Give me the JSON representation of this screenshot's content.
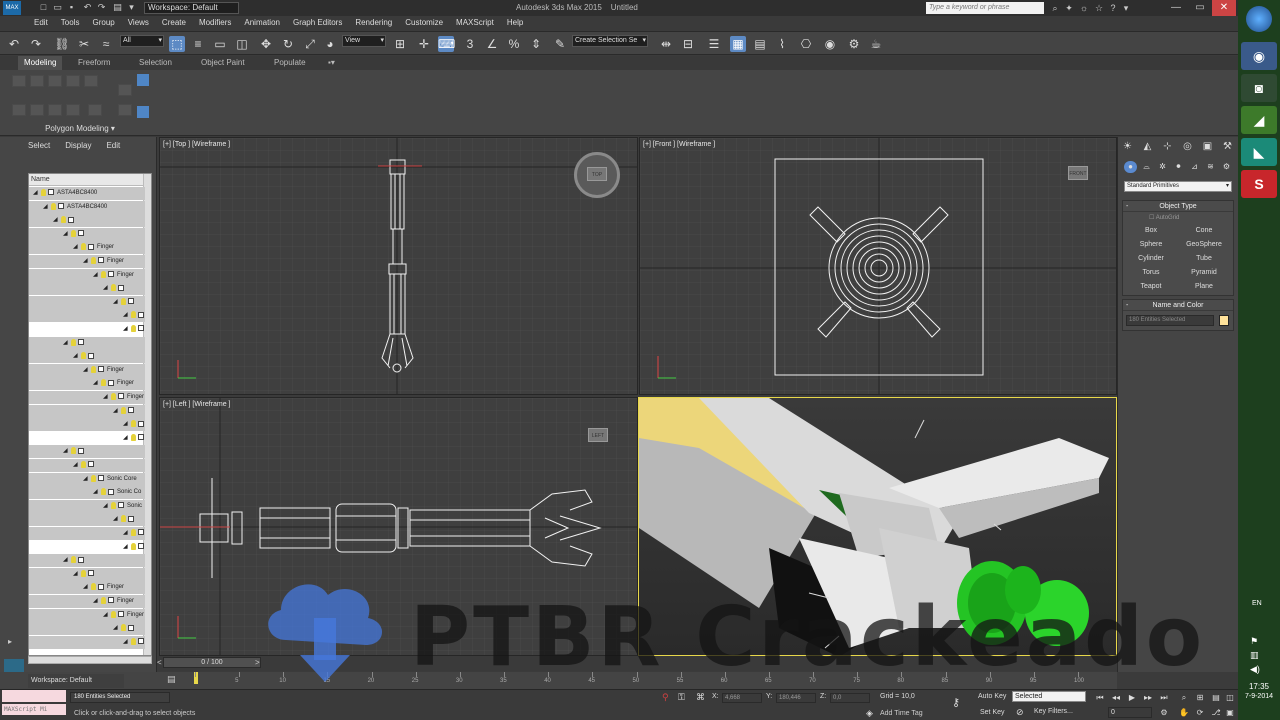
{
  "window": {
    "title": "Autodesk 3ds Max 2015",
    "document": "Untitled",
    "workspace": "Workspace: Default",
    "search_placeholder": "Type a keyword or phrase"
  },
  "menu": [
    "Edit",
    "Tools",
    "Group",
    "Views",
    "Create",
    "Modifiers",
    "Animation",
    "Graph Editors",
    "Rendering",
    "Customize",
    "MAXScript",
    "Help"
  ],
  "toolbar": {
    "filter": "All",
    "ref_coord": "View",
    "named_selection": "Create Selection Se"
  },
  "ribbon": {
    "tabs": [
      "Modeling",
      "Freeform",
      "Selection",
      "Object Paint",
      "Populate"
    ],
    "panel_label": "Polygon Modeling ▾"
  },
  "scene_explorer": {
    "menus": [
      "Select",
      "Display",
      "Edit"
    ],
    "column": "Name",
    "rows": [
      {
        "indent": 0,
        "label": "ASTA4BC8400",
        "sel": true
      },
      {
        "indent": 1,
        "label": "ASTA4BC8400",
        "sel": true
      },
      {
        "indent": 2,
        "label": "",
        "sel": true
      },
      {
        "indent": 3,
        "label": "",
        "sel": true
      },
      {
        "indent": 4,
        "label": "Finger",
        "sel": true
      },
      {
        "indent": 5,
        "label": "Finger",
        "sel": true
      },
      {
        "indent": 6,
        "label": "Finger",
        "sel": true
      },
      {
        "indent": 7,
        "label": "",
        "sel": true
      },
      {
        "indent": 8,
        "label": "",
        "sel": true
      },
      {
        "indent": 9,
        "label": "",
        "sel": true
      },
      {
        "indent": 9,
        "label": "",
        "sel": false
      },
      {
        "indent": 3,
        "label": "",
        "sel": true
      },
      {
        "indent": 4,
        "label": "",
        "sel": true
      },
      {
        "indent": 5,
        "label": "Finger",
        "sel": true
      },
      {
        "indent": 6,
        "label": "Finger",
        "sel": true
      },
      {
        "indent": 7,
        "label": "Finger",
        "sel": true
      },
      {
        "indent": 8,
        "label": "",
        "sel": true
      },
      {
        "indent": 9,
        "label": "",
        "sel": true
      },
      {
        "indent": 9,
        "label": "",
        "sel": false
      },
      {
        "indent": 3,
        "label": "",
        "sel": true
      },
      {
        "indent": 4,
        "label": "",
        "sel": true
      },
      {
        "indent": 5,
        "label": "Sonic Core",
        "sel": true
      },
      {
        "indent": 6,
        "label": "Sonic Co",
        "sel": true
      },
      {
        "indent": 7,
        "label": "Sonic",
        "sel": true
      },
      {
        "indent": 8,
        "label": "",
        "sel": true
      },
      {
        "indent": 9,
        "label": "",
        "sel": true
      },
      {
        "indent": 9,
        "label": "",
        "sel": false
      },
      {
        "indent": 3,
        "label": "",
        "sel": true
      },
      {
        "indent": 4,
        "label": "",
        "sel": true
      },
      {
        "indent": 5,
        "label": "Finger",
        "sel": true
      },
      {
        "indent": 6,
        "label": "Finger",
        "sel": true
      },
      {
        "indent": 7,
        "label": "Finger",
        "sel": true
      },
      {
        "indent": 8,
        "label": "",
        "sel": true
      },
      {
        "indent": 9,
        "label": "",
        "sel": true
      }
    ]
  },
  "viewports": {
    "top": "[+] [Top ] [Wireframe ]",
    "front": "[+] [Front ] [Wireframe ]",
    "left": "[+] [Left ] [Wireframe ]"
  },
  "command_panel": {
    "category": "Standard Primitives",
    "object_type_title": "Object Type",
    "autogrid": "AutoGrid",
    "primitives": [
      "Box",
      "Cone",
      "Sphere",
      "GeoSphere",
      "Cylinder",
      "Tube",
      "Torus",
      "Pyramid",
      "Teapot",
      "Plane"
    ],
    "name_color_title": "Name and Color",
    "name_value": "180 Entities Selected",
    "object_color": "#ffe29a"
  },
  "timeline": {
    "slider": "0 / 100",
    "ticks": [
      "0",
      "5",
      "10",
      "15",
      "20",
      "25",
      "30",
      "35",
      "40",
      "45",
      "50",
      "55",
      "60",
      "65",
      "70",
      "75",
      "80",
      "85",
      "90",
      "95",
      "100"
    ]
  },
  "status": {
    "workspace": "Workspace: Default",
    "maxscript": "MAXScript Mi",
    "selection": "180 Entities Selected",
    "prompt": "Click or click-and-drag to select objects",
    "x_label": "X:",
    "x": "4,668",
    "y_label": "Y:",
    "y": "180,446",
    "z_label": "Z:",
    "z": "0,0",
    "grid": "Grid = 10,0",
    "add_time_tag": "Add Time Tag",
    "auto_key": "Auto Key",
    "key_mode": "Selected",
    "set_key": "Set Key",
    "key_filters": "Key Filters...",
    "frame": "0"
  },
  "taskbar": {
    "lang": "EN",
    "time": "17:35",
    "date": "7-9-2014"
  },
  "watermark": "PTBR Crackeado"
}
